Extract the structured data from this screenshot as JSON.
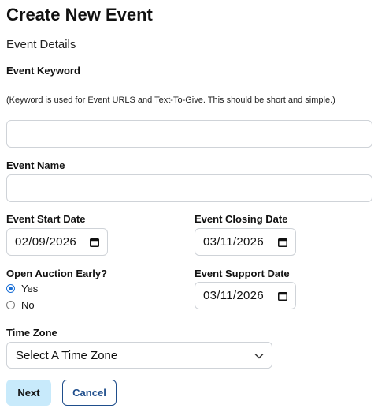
{
  "page": {
    "title": "Create New Event",
    "section_title": "Event Details"
  },
  "form": {
    "keyword": {
      "label": "Event Keyword",
      "note": "(Keyword is used for Event URLS and Text-To-Give. This should be short and simple.)",
      "value": ""
    },
    "name": {
      "label": "Event Name",
      "value": ""
    },
    "start_date": {
      "label": "Event Start Date",
      "value": "02/09/2026"
    },
    "closing_date": {
      "label": "Event Closing Date",
      "value": "03/11/2026"
    },
    "open_auction_early": {
      "label": "Open Auction Early?",
      "options": [
        {
          "label": "Yes",
          "selected": true
        },
        {
          "label": "No",
          "selected": false
        }
      ]
    },
    "support_date": {
      "label": "Event Support Date",
      "value": "03/11/2026"
    },
    "time_zone": {
      "label": "Time Zone",
      "selected": "Select A Time Zone"
    }
  },
  "buttons": {
    "next": "Next",
    "cancel": "Cancel"
  },
  "colors": {
    "next_bg": "#c8eafb",
    "cancel_border": "#1f4e8c",
    "radio_accent": "#1a6fd6",
    "input_border": "#cfd3d8"
  },
  "icons": {
    "date": "calendar-icon",
    "select": "chevron-down-icon"
  }
}
